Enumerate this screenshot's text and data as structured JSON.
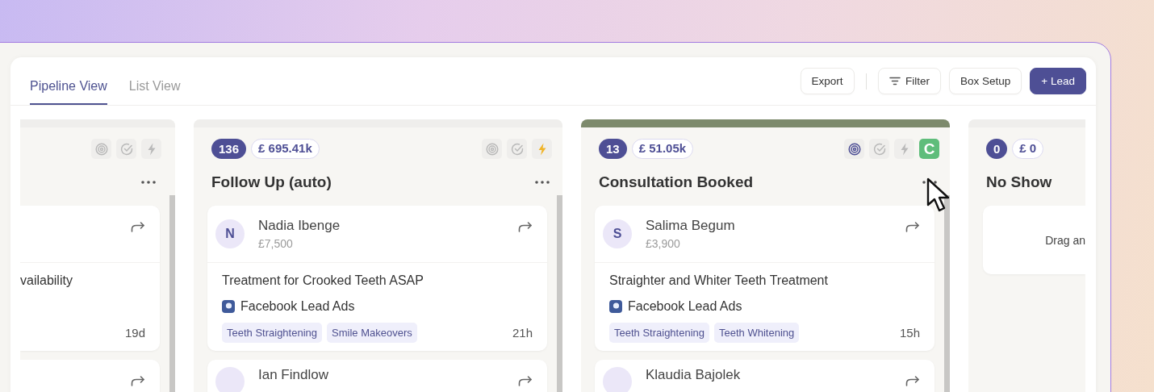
{
  "tabs": [
    {
      "label": "Pipeline View",
      "selected": true
    },
    {
      "label": "List View",
      "selected": false
    }
  ],
  "action_groups": [
    [
      {
        "label": "Export",
        "kind": "plain"
      }
    ],
    [
      {
        "label": "Filter",
        "kind": "filter"
      },
      {
        "label": "Box Setup",
        "kind": "plain"
      },
      {
        "label": "+ Lead",
        "kind": "primary"
      }
    ]
  ],
  "columns": [
    {
      "kind": "cut_left",
      "color": "#efeeec",
      "tools": [
        {
          "kind": "goal",
          "active": false
        },
        {
          "kind": "check",
          "active": false
        },
        {
          "kind": "bolt",
          "active": false
        }
      ],
      "cards": [
        {
          "kind": "lead",
          "title": "vailability",
          "age": "19d"
        },
        {
          "kind": "lead"
        }
      ]
    },
    {
      "kind": "full",
      "color": "#efeeec",
      "count": "136",
      "value": "£ 695.41k",
      "title": "Follow Up (auto)",
      "tools": [
        {
          "kind": "goal",
          "active": false
        },
        {
          "kind": "check",
          "active": false
        },
        {
          "kind": "bolt",
          "active": true
        }
      ],
      "cards": [
        {
          "kind": "lead",
          "initial": "N",
          "name": "Nadia Ibenge",
          "amount": "£7,500",
          "title": "Treatment for Crooked Teeth ASAP",
          "source": "Facebook Lead Ads",
          "tags": [
            "Teeth Straightening",
            "Smile Makeovers"
          ],
          "age": "21h"
        },
        {
          "kind": "lead",
          "name": "Ian Findlow"
        }
      ]
    },
    {
      "kind": "full",
      "color": "#7d8a6c",
      "count": "13",
      "value": "£ 51.05k",
      "title": "Consultation Booked",
      "badge": "C",
      "tools": [
        {
          "kind": "goal",
          "active": true
        },
        {
          "kind": "check",
          "active": false
        },
        {
          "kind": "bolt",
          "active": false
        }
      ],
      "cards": [
        {
          "kind": "lead",
          "initial": "S",
          "name": "Salima Begum",
          "amount": "£3,900",
          "title": "Straighter and Whiter Teeth Treatment",
          "source": "Facebook Lead Ads",
          "tags": [
            "Teeth Straightening",
            "Teeth Whitening"
          ],
          "age": "15h"
        },
        {
          "kind": "lead",
          "name": "Klaudia Bajolek"
        }
      ]
    },
    {
      "kind": "cut_right",
      "color": "#efeeec",
      "count": "0",
      "value": "£ 0",
      "title": "No Show",
      "cards": [
        {
          "kind": "empty",
          "text": "Drag an"
        }
      ]
    }
  ]
}
